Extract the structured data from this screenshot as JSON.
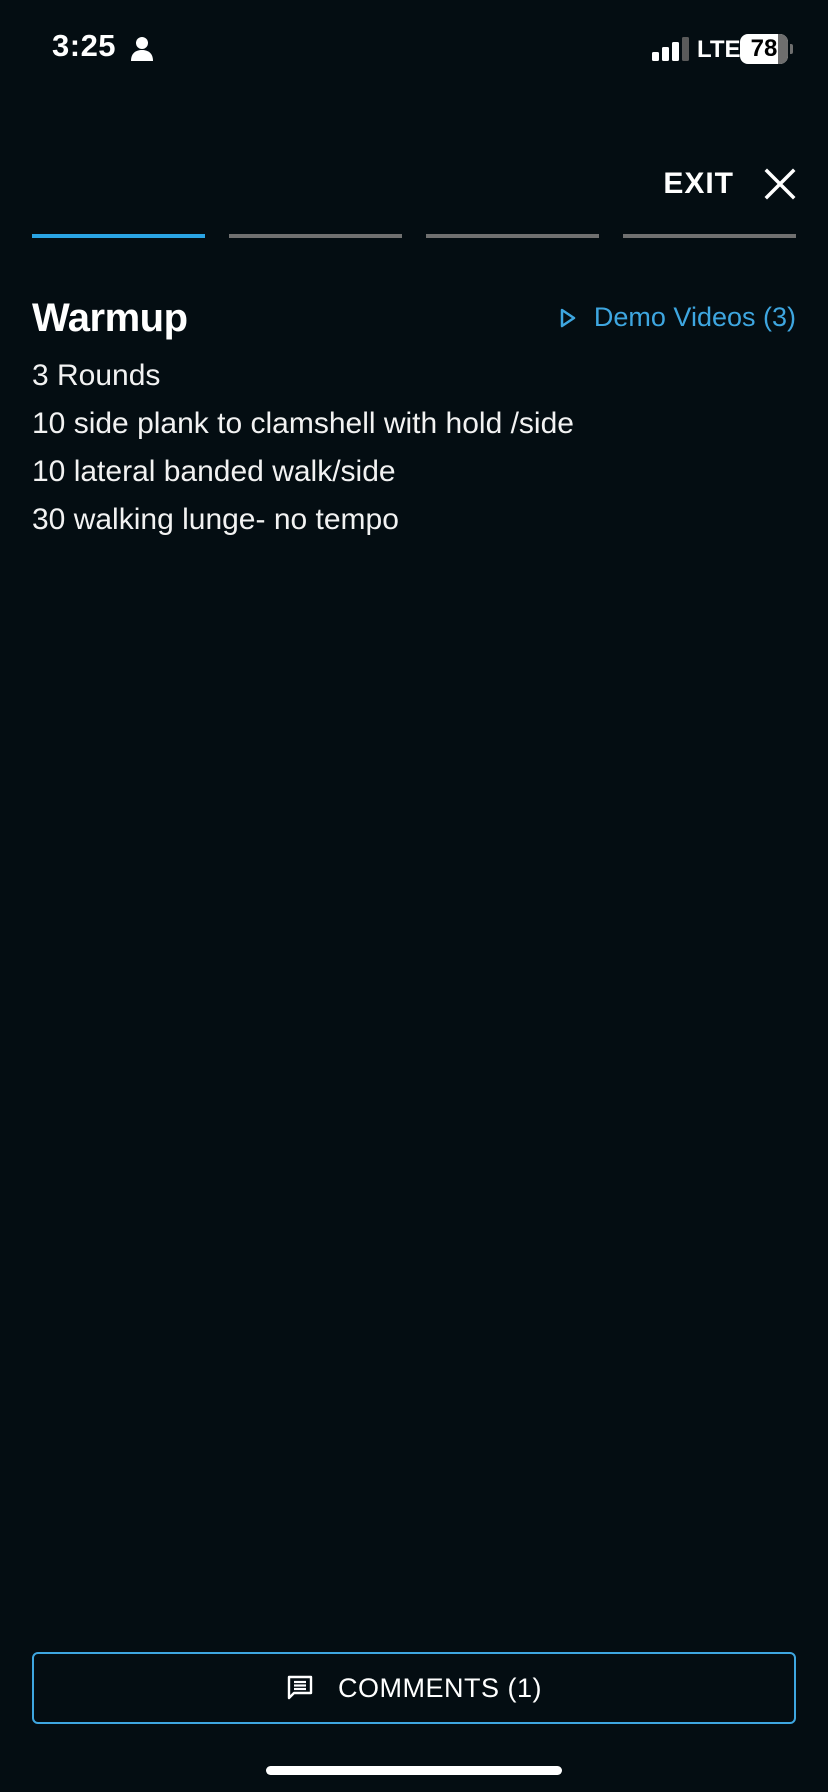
{
  "status_bar": {
    "time": "3:25",
    "network": "LTE",
    "battery": "78",
    "battery_level_percent": 78,
    "icons": [
      "person-icon",
      "signal-icon",
      "battery-icon"
    ]
  },
  "header": {
    "exit_label": "EXIT",
    "close_icon": "close-icon"
  },
  "progress": {
    "total_segments": 4,
    "active_segment": 1,
    "active_color": "#2aa4e4",
    "inactive_color": "#707070"
  },
  "section": {
    "title": "Warmup",
    "demo_link": "Demo Videos (3)",
    "demo_icon": "play-icon",
    "lines": [
      "3 Rounds",
      "10 side plank to clamshell with hold /side",
      "10 lateral banded walk/side",
      "30 walking lunge- no tempo"
    ]
  },
  "footer": {
    "comments_label": "COMMENTS (1)",
    "comment_icon": "comment-icon",
    "accent_color": "#3ea6e0"
  },
  "colors": {
    "background": "#040d12",
    "text": "#ffffff",
    "accent": "#3ea6e0"
  }
}
